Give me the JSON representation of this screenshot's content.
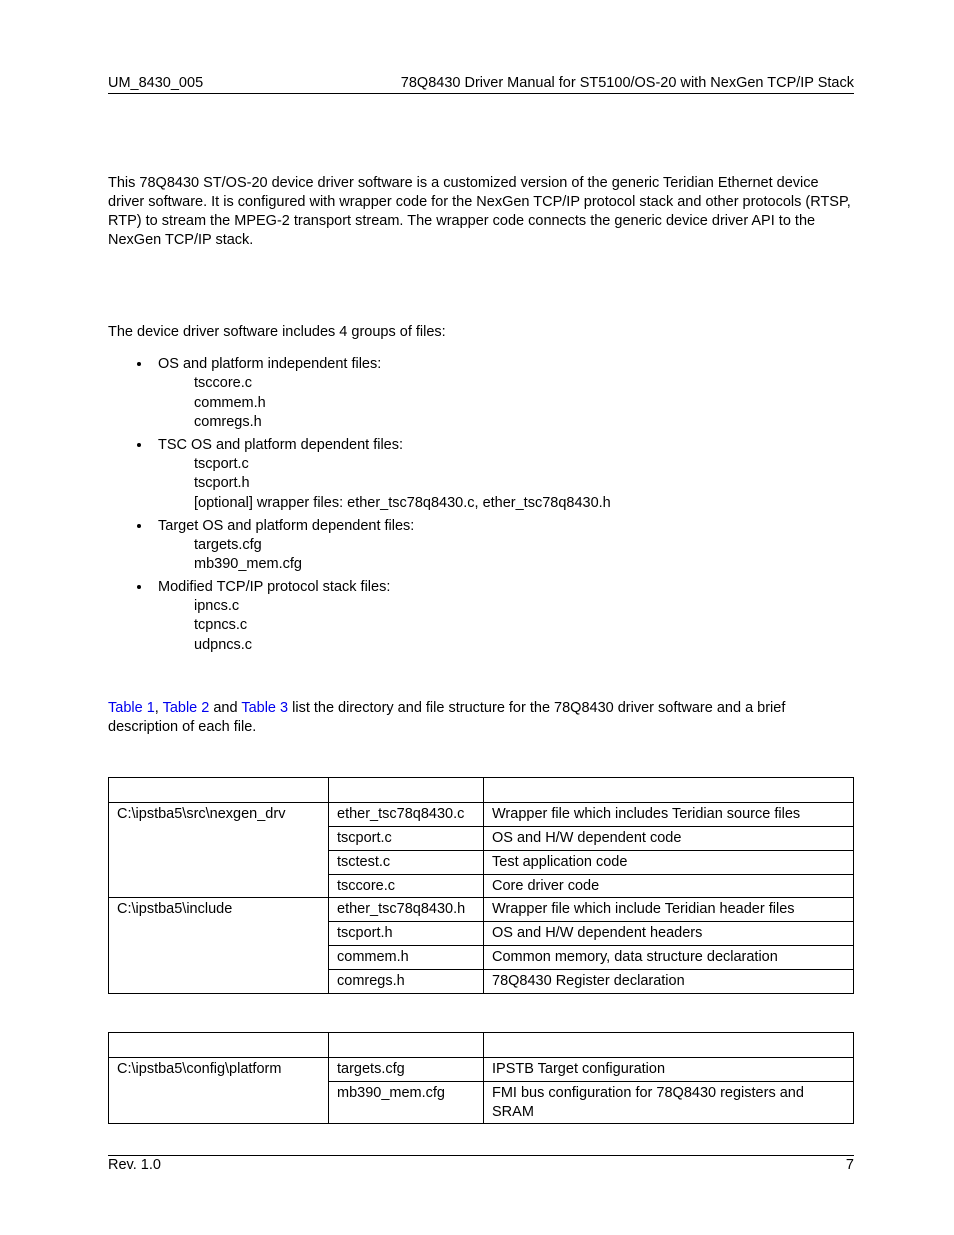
{
  "header": {
    "left": "UM_8430_005",
    "right": "78Q8430 Driver Manual for ST5100/OS-20 with NexGen TCP/IP Stack"
  },
  "intro_para": "This 78Q8430 ST/OS-20 device driver software is a customized version of the generic Teridian Ethernet device driver software.  It is configured with wrapper code for the NexGen TCP/IP protocol stack and other protocols (RTSP, RTP) to stream the MPEG-2 transport stream.  The wrapper code connects the generic device driver API to the NexGen TCP/IP stack.",
  "groups_intro": "The device driver software includes 4 groups of files:",
  "groups": [
    {
      "title": "OS and platform independent files:",
      "items": [
        "tsccore.c",
        "commem.h",
        "comregs.h"
      ]
    },
    {
      "title": "TSC OS and platform dependent files:",
      "items": [
        "tscport.c",
        "tscport.h",
        "[optional] wrapper files: ether_tsc78q8430.c, ether_tsc78q8430.h"
      ]
    },
    {
      "title": "Target OS and platform dependent files:",
      "items": [
        "targets.cfg",
        "mb390_mem.cfg"
      ]
    },
    {
      "title": "Modified TCP/IP protocol stack files:",
      "items": [
        "ipncs.c",
        "tcpncs.c",
        "udpncs.c"
      ]
    }
  ],
  "tables_intro": {
    "link1": "Table 1",
    "sep1": ", ",
    "link2": "Table 2",
    "sep2": " and ",
    "link3": "Table 3",
    "tail": " list the directory and file structure for the 78Q8430 driver software and a brief description of each file."
  },
  "table1": {
    "rows": [
      {
        "dir": "C:\\ipstba5\\src\\nexgen_drv",
        "file": "ether_tsc78q8430.c",
        "desc": "Wrapper file which includes Teridian source files"
      },
      {
        "dir": "",
        "file": "tscport.c",
        "desc": "OS and H/W dependent code"
      },
      {
        "dir": "",
        "file": "tsctest.c",
        "desc": "Test application code"
      },
      {
        "dir": "",
        "file": "tsccore.c",
        "desc": "Core driver code"
      },
      {
        "dir": "C:\\ipstba5\\include",
        "file": "ether_tsc78q8430.h",
        "desc": "Wrapper file which include Teridian header files"
      },
      {
        "dir": "",
        "file": "tscport.h",
        "desc": "OS and H/W dependent headers"
      },
      {
        "dir": "",
        "file": "commem.h",
        "desc": "Common memory, data structure declaration"
      },
      {
        "dir": "",
        "file": "comregs.h",
        "desc": "78Q8430 Register declaration"
      }
    ]
  },
  "table2": {
    "rows": [
      {
        "dir": "C:\\ipstba5\\config\\platform",
        "file": "targets.cfg",
        "desc": "IPSTB Target configuration"
      },
      {
        "dir": "",
        "file": "mb390_mem.cfg",
        "desc": "FMI bus configuration for 78Q8430 registers and SRAM"
      }
    ]
  },
  "footer": {
    "left": "Rev. 1.0",
    "right": "7"
  }
}
